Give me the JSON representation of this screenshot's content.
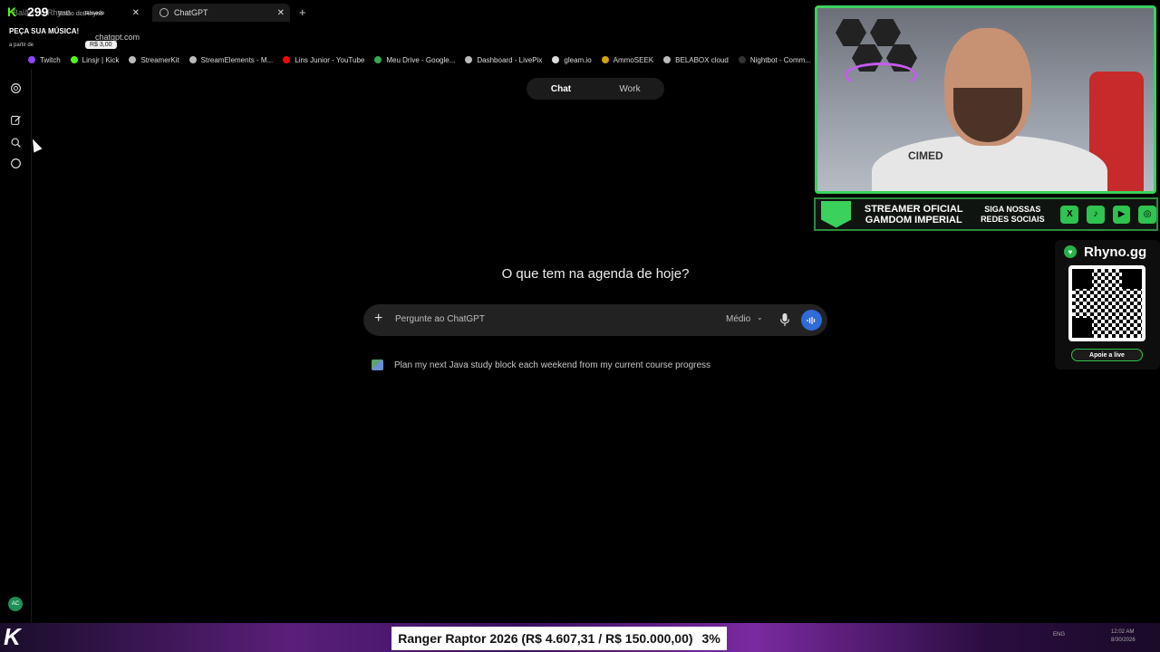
{
  "browser": {
    "tabs": [
      {
        "label": "Balão do Rhyno",
        "active": false
      },
      {
        "label": "ChatGPT",
        "active": true
      }
    ],
    "new_tab_label": "+",
    "url": "chatgpt.com",
    "bookmarks": [
      {
        "label": "Twitch",
        "color": "#9146ff"
      },
      {
        "label": "Linsjr | Kick",
        "color": "#53fc18"
      },
      {
        "label": "StreamerKit",
        "color": "#bbbbbb"
      },
      {
        "label": "StreamElements - M...",
        "color": "#bbbbbb"
      },
      {
        "label": "Lins Junior - YouTube",
        "color": "#ff0000"
      },
      {
        "label": "Meu Drive - Google...",
        "color": "#34a853"
      },
      {
        "label": "Dashboard - LivePix",
        "color": "#bbbbbb"
      },
      {
        "label": "gleam.io",
        "color": "#dddddd"
      },
      {
        "label": "AmmoSEEK",
        "color": "#d4a017"
      },
      {
        "label": "BELABOX cloud",
        "color": "#bbbbbb"
      },
      {
        "label": "Nightbot - Comm...",
        "color": "#333333"
      }
    ]
  },
  "stream_overlay": {
    "viewer_count": "299",
    "channel": "Balão do Rhyno",
    "status": "pausado",
    "promo_title": "PEÇA SUA MÚSICA!",
    "promo_subtitle": "a partir de",
    "promo_price": "R$ 3,00"
  },
  "chat": {
    "modes": [
      "Chat",
      "Work"
    ],
    "active_mode": "Chat",
    "headline": "O que tem na agenda de hoje?",
    "composer_placeholder": "Pergunte ao ChatGPT",
    "model_selector": "Médio",
    "suggestion": "Plan my next Java study block each weekend from my current course progress"
  },
  "sidebar": {
    "avatar_initials": "AC"
  },
  "webcam": {
    "shirt_text": "CIMED"
  },
  "banner": {
    "line1": "STREAMER OFICIAL",
    "line2": "GAMDOM IMPERIAL",
    "social_line1": "SIGA NOSSAS",
    "social_line2": "REDES SOCIAIS"
  },
  "donation": {
    "title": "Rhyno.gg",
    "button": "Apoie a live"
  },
  "goal": {
    "text": "Ranger Raptor 2026 (R$ 4.607,31 / R$ 150.000,00)",
    "percent": "3%"
  },
  "taskbar": {
    "lang": "ENG",
    "time": "12:02 AM",
    "date": "8/30/2026"
  }
}
